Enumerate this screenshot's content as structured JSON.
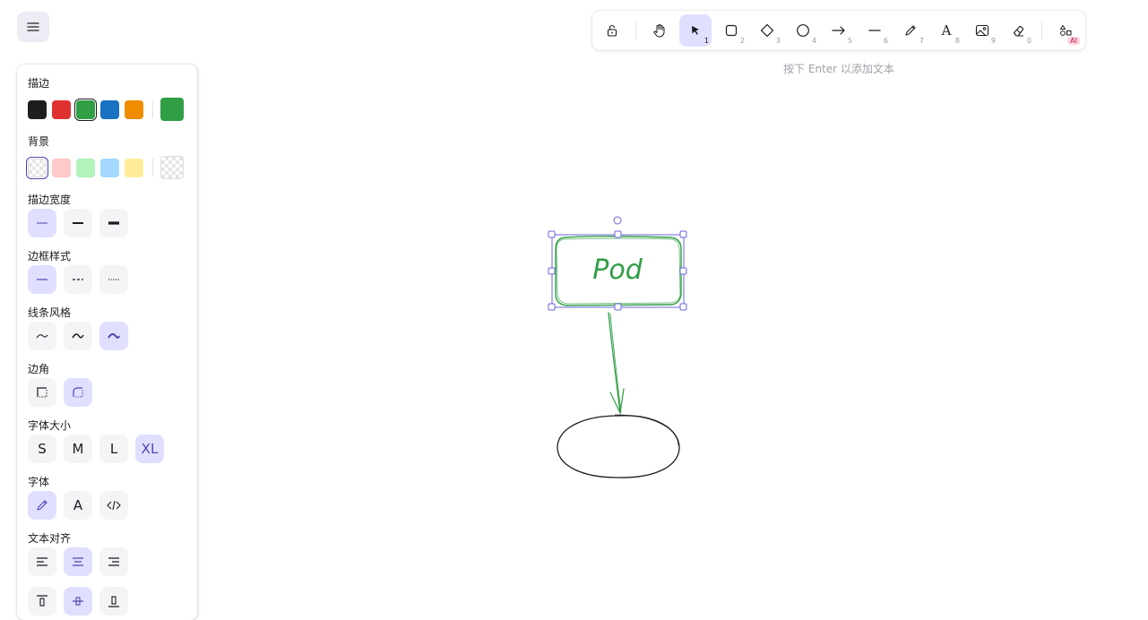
{
  "menu": {
    "icon": "hamburger-icon"
  },
  "panel": {
    "stroke_label": "描边",
    "stroke_colors": [
      "#1e1e1e",
      "#e03131",
      "#2f9e44",
      "#1971c2",
      "#f08c00"
    ],
    "stroke_selected": "#2f9e44",
    "background_label": "背景",
    "background_colors": [
      "transparent",
      "#ffc9c9",
      "#b2f2bb",
      "#a5d8ff",
      "#ffec99"
    ],
    "stroke_width_label": "描边宽度",
    "stroke_style_label": "边框样式",
    "sloppiness_label": "线条风格",
    "edges_label": "边角",
    "font_size_label": "字体大小",
    "font_sizes": [
      "S",
      "M",
      "L",
      "XL"
    ],
    "font_family_label": "字体",
    "font_family_icons": [
      "pencil-icon",
      "normal-font-icon",
      "code-icon"
    ],
    "font_family_normal_glyph": "A",
    "text_align_label": "文本对齐"
  },
  "toolbar": {
    "tools": [
      {
        "name": "lock-icon",
        "key": ""
      },
      {
        "name": "hand-icon",
        "key": ""
      },
      {
        "name": "selection-icon",
        "key": "1"
      },
      {
        "name": "rectangle-icon",
        "key": "2"
      },
      {
        "name": "diamond-icon",
        "key": "3"
      },
      {
        "name": "ellipse-icon",
        "key": "4"
      },
      {
        "name": "arrow-icon",
        "key": "5"
      },
      {
        "name": "line-icon",
        "key": "6"
      },
      {
        "name": "pencil-icon",
        "key": "7"
      },
      {
        "name": "text-icon",
        "key": "8"
      },
      {
        "name": "image-icon",
        "key": "9"
      },
      {
        "name": "eraser-icon",
        "key": "0"
      },
      {
        "name": "shapes-icon",
        "key": ""
      }
    ],
    "ai_badge": "AI",
    "text_glyph": "A"
  },
  "hint": "按下 Enter 以添加文本",
  "canvas": {
    "node_label": "Pod",
    "node_color": "#2f9e44",
    "selection_color": "#6965db"
  }
}
